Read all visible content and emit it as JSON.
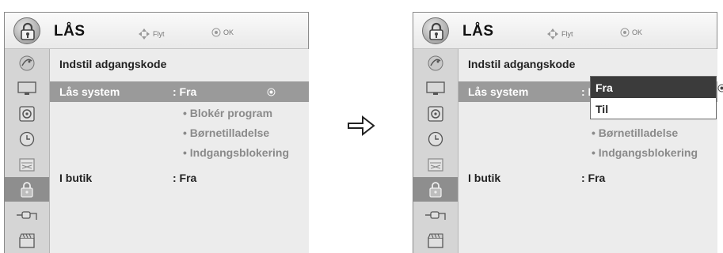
{
  "menu": {
    "title": "LÅS",
    "hint_move": "Flyt",
    "hint_ok": "OK"
  },
  "sidebar": {
    "items": [
      {
        "icon": "satellite-dish-icon"
      },
      {
        "icon": "monitor-icon"
      },
      {
        "icon": "speaker-icon"
      },
      {
        "icon": "clock-icon"
      },
      {
        "icon": "calendar-icon"
      },
      {
        "icon": "lock-icon",
        "active": true
      },
      {
        "icon": "plug-icon"
      },
      {
        "icon": "clapperboard-icon"
      }
    ]
  },
  "options": {
    "password_label": "Indstil adgangskode",
    "lock_system_label": "Lås system",
    "lock_system_value": ": Fra",
    "lock_system_value_short": ": F",
    "sub_items": [
      "Blokér program",
      "Børnetilladelse",
      "Indgangsblokering"
    ],
    "store_label": "I butik",
    "store_value": ": Fra"
  },
  "dropdown": {
    "options": [
      "Fra",
      "Til"
    ],
    "selected": "Fra"
  },
  "colors": {
    "highlight_row": "#9a9a9a",
    "dropdown_selected": "#3b3b3b",
    "sidebar_active": "#8e8e8e"
  }
}
